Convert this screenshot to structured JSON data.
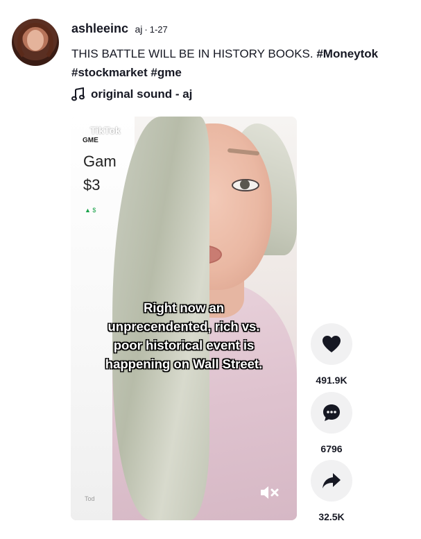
{
  "post": {
    "username": "ashleeinc",
    "nickname": "aj",
    "separator": "·",
    "date": "1-27",
    "caption_text": "THIS BATTLE WILL BE IN HISTORY BOOKS. ",
    "hashtags": [
      "#Moneytok",
      "#stockmarket",
      "#gme"
    ],
    "music": "original sound - aj"
  },
  "video": {
    "watermark": "TikTok",
    "ticker": "GME",
    "stock_name_partial": "Gam",
    "stock_price_partial": "$3",
    "stock_change_partial": "▲ $",
    "footer_partial": "Tod",
    "overlay_text_lines": [
      "Right now an",
      "unprecendented, rich vs.",
      "poor historical event is",
      "happening on Wall Street."
    ]
  },
  "actions": {
    "like_count": "491.9K",
    "comment_count": "6796",
    "share_count": "32.5K"
  }
}
